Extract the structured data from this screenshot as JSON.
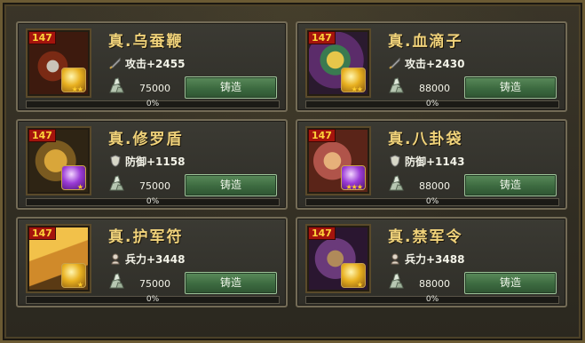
{
  "cards": [
    {
      "level": "147",
      "name": "真.乌蚕鞭",
      "stat_type": "attack",
      "stat": "攻击+2455",
      "cost": "75000",
      "button": "铸造",
      "progress_pct": 0,
      "progress_text": "0%",
      "gem": "gold",
      "stars": "★★",
      "art": "whip"
    },
    {
      "level": "147",
      "name": "真.血滴子",
      "stat_type": "attack",
      "stat": "攻击+2430",
      "cost": "88000",
      "button": "铸造",
      "progress_pct": 0,
      "progress_text": "0%",
      "gem": "gold",
      "stars": "★★",
      "art": "flying-guillotine"
    },
    {
      "level": "147",
      "name": "真.修罗盾",
      "stat_type": "defense",
      "stat": "防御+1158",
      "cost": "75000",
      "button": "铸造",
      "progress_pct": 0,
      "progress_text": "0%",
      "gem": "purple",
      "stars": "★",
      "art": "shield"
    },
    {
      "level": "147",
      "name": "真.八卦袋",
      "stat_type": "defense",
      "stat": "防御+1143",
      "cost": "88000",
      "button": "铸造",
      "progress_pct": 0,
      "progress_text": "0%",
      "gem": "purple",
      "stars": "★★★",
      "art": "bagua-pouch"
    },
    {
      "level": "147",
      "name": "真.护军符",
      "stat_type": "troops",
      "stat": "兵力+3448",
      "cost": "75000",
      "button": "铸造",
      "progress_pct": 0,
      "progress_text": "0%",
      "gem": "gold",
      "stars": "★",
      "art": "talisman"
    },
    {
      "level": "147",
      "name": "真.禁军令",
      "stat_type": "troops",
      "stat": "兵力+3488",
      "cost": "88000",
      "button": "铸造",
      "progress_pct": 0,
      "progress_text": "0%",
      "gem": "gold",
      "stars": "★",
      "art": "command-token"
    }
  ],
  "icons": {
    "attack": "sword-icon",
    "defense": "shield-icon",
    "troops": "soldier-icon",
    "cost": "ore-icon"
  },
  "colors": {
    "title_gold": "#f0d27a",
    "button_green": "#3c6a40",
    "level_badge_red": "#a4140d",
    "gem_gold": "#e8b020",
    "gem_purple": "#9a3bd6"
  }
}
